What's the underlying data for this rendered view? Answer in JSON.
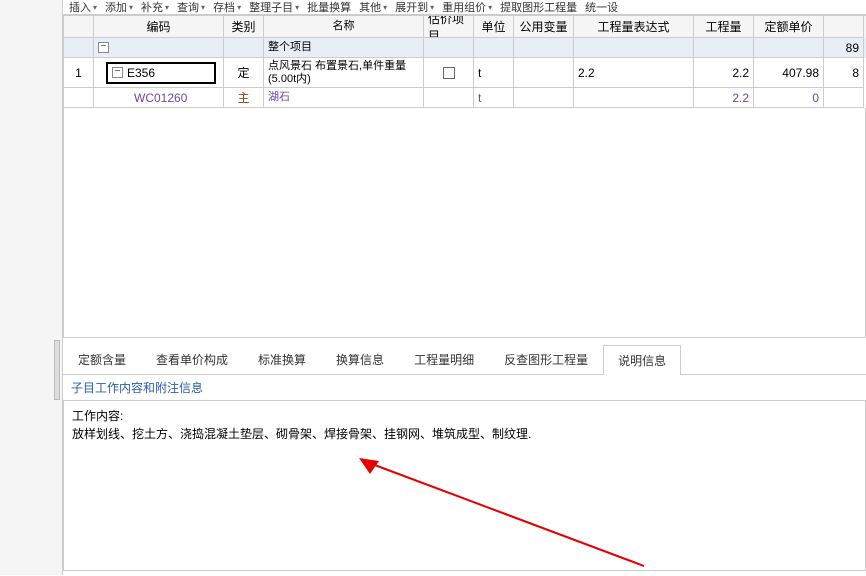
{
  "toolbar": {
    "items": [
      "插入",
      "添加",
      "补充",
      "查询",
      "存档",
      "整理子目",
      "批量换算",
      "其他",
      "展开到",
      "重用组价",
      "提取图形工程量",
      "统一设"
    ]
  },
  "grid": {
    "headers": [
      "",
      "编码",
      "类别",
      "名称",
      "估价项目",
      "单位",
      "公用变量",
      "工程量表达式",
      "工程量",
      "定额单价",
      ""
    ],
    "section_label": "整个项目",
    "section_total": "89",
    "rows": [
      {
        "seq": "1",
        "code": "E356",
        "type": "定",
        "name": "点风景石 布置景石,单件重量(5.00t内)",
        "unit": "t",
        "expr": "2.2",
        "qty": "2.2",
        "price": "407.98",
        "total": "8"
      },
      {
        "seq": "",
        "code": "WC01260",
        "type": "主",
        "name": "湖石",
        "unit": "t",
        "expr": "",
        "qty": "2.2",
        "price": "0",
        "total": ""
      }
    ]
  },
  "tabs": {
    "items": [
      "定额含量",
      "查看单价构成",
      "标准换算",
      "换算信息",
      "工程量明细",
      "反查图形工程量",
      "说明信息"
    ],
    "active": 6,
    "subtab": "子目工作内容和附注信息"
  },
  "content": {
    "title": "工作内容:",
    "body": "放样划线、挖土方、浇捣混凝土垫层、砌骨架、焊接骨架、挂钢网、堆筑成型、制纹理."
  }
}
